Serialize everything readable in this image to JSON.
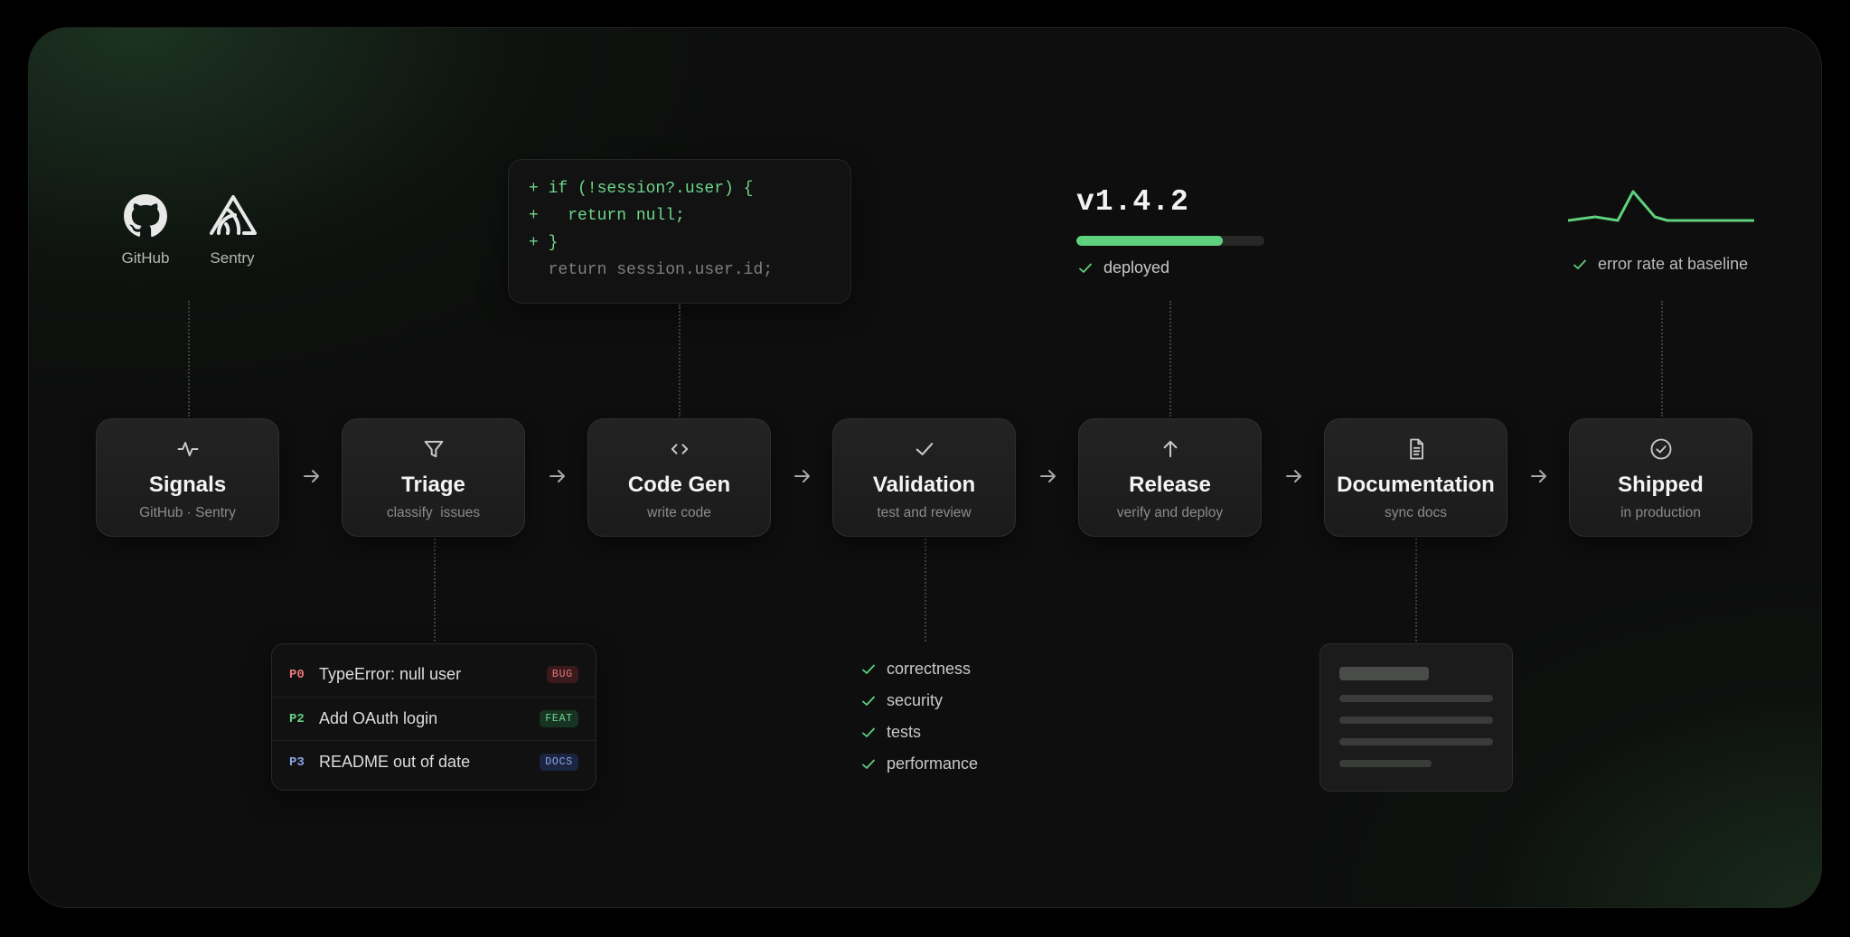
{
  "sources": [
    {
      "label": "GitHub",
      "icon": "github-icon"
    },
    {
      "label": "Sentry",
      "icon": "sentry-icon"
    }
  ],
  "code_snippet": {
    "lines": [
      {
        "text": "+ if (!session?.user) {",
        "kind": "added"
      },
      {
        "text": "+   return null;",
        "kind": "added"
      },
      {
        "text": "+ }",
        "kind": "added"
      },
      {
        "text": "  return session.user.id;",
        "kind": "context"
      }
    ]
  },
  "release_panel": {
    "version": "v1.4.2",
    "progress": 0.78,
    "status": "deployed"
  },
  "monitor_panel": {
    "status": "error rate at baseline",
    "sparkline": [
      2,
      3,
      2,
      10,
      3,
      2,
      2,
      2
    ]
  },
  "pipeline": [
    {
      "title": "Signals",
      "subtitle": "GitHub · Sentry",
      "icon": "pulse-icon"
    },
    {
      "title": "Triage",
      "subtitle": "classify  issues",
      "icon": "filter-icon"
    },
    {
      "title": "Code Gen",
      "subtitle": "write code",
      "icon": "code-icon"
    },
    {
      "title": "Validation",
      "subtitle": "test and review",
      "icon": "check-icon"
    },
    {
      "title": "Release",
      "subtitle": "verify and deploy",
      "icon": "arrow-up-icon"
    },
    {
      "title": "Documentation",
      "subtitle": "sync docs",
      "icon": "document-icon"
    },
    {
      "title": "Shipped",
      "subtitle": "in production",
      "icon": "check-circle-icon"
    }
  ],
  "issues": [
    {
      "priority": "P0",
      "title": "TypeError: null user",
      "tag": "BUG"
    },
    {
      "priority": "P2",
      "title": "Add OAuth login",
      "tag": "FEAT"
    },
    {
      "priority": "P3",
      "title": "README out of date",
      "tag": "DOCS"
    }
  ],
  "validation_checks": [
    "correctness",
    "security",
    "tests",
    "performance"
  ],
  "colors": {
    "accent_green": "#5fd07e",
    "p0": "#e8787a",
    "p2": "#66cf86",
    "p3": "#8aa6e8",
    "bug_bg": "#3a1a1c",
    "bug_fg": "#e07a7c",
    "feat_bg": "#173322",
    "feat_fg": "#6fd58b",
    "docs_bg": "#1b2440",
    "docs_fg": "#8ea8ec"
  }
}
